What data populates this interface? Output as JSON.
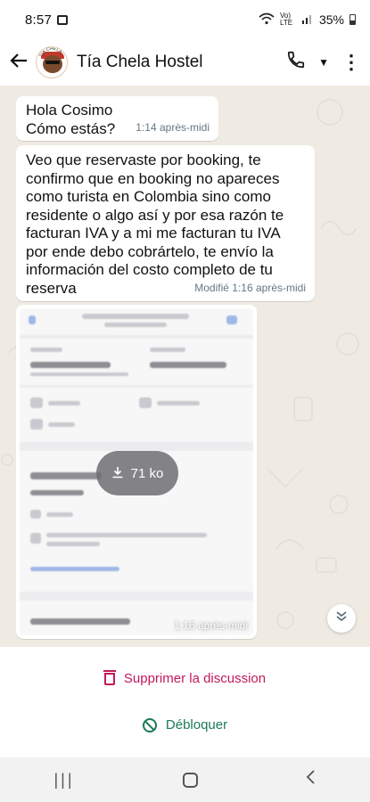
{
  "status_bar": {
    "time": "8:57",
    "signal_text": "Vo) LTE",
    "battery": "35%"
  },
  "header": {
    "back_icon": "arrow-left-icon",
    "contact_name": "Tía Chela Hostel",
    "avatar_text": "TÍA CHELA",
    "actions": [
      "phone-icon",
      "caret-down-icon",
      "more-vert-icon"
    ]
  },
  "messages": [
    {
      "type": "text",
      "lines": [
        "Hola Cosimo",
        "Cómo estás?"
      ],
      "time": "1:14 après-midi"
    },
    {
      "type": "text",
      "text": "Veo que reservaste por booking, te confirmo que en booking no apareces como turista en Colombia sino como residente o algo así y por esa razón te facturan IVA y a mi me facturan tu IVA por ende debo cobrártelo, te envío la información del costo completo de tu reserva",
      "time": "Modifié 1:16 après-midi"
    },
    {
      "type": "image",
      "download_size": "71 ko",
      "time": "1:16 après-midi"
    }
  ],
  "footer": {
    "delete_label": "Supprimer la discussion",
    "unblock_label": "Débloquer"
  },
  "colors": {
    "delete": "#c2185b",
    "unblock": "#1b7a55",
    "chat_bg": "#efeae2"
  }
}
